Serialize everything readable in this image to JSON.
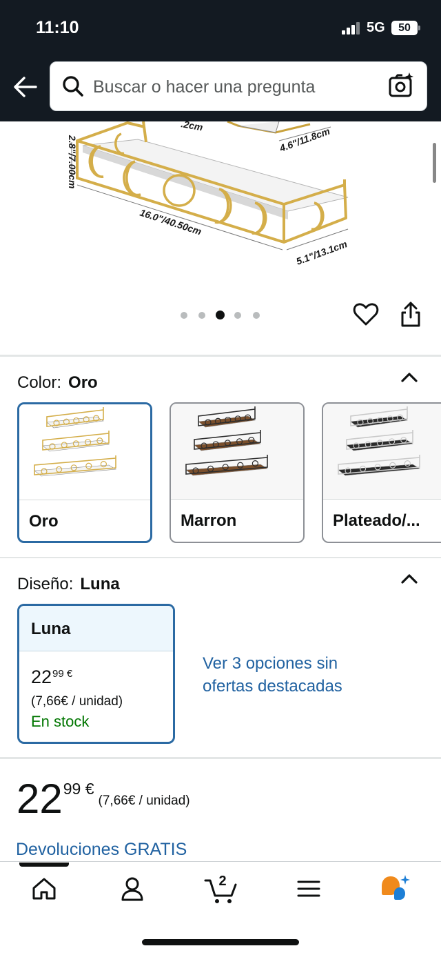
{
  "status_bar": {
    "time": "11:10",
    "network": "5G",
    "battery": "50"
  },
  "search": {
    "placeholder": "Buscar o hacer una pregunta",
    "icons": [
      "back-arrow-icon",
      "search-icon",
      "camera-icon"
    ]
  },
  "product_image": {
    "dimension_labels": [
      "2.8\"/7.00cm",
      "16.0\"/40.50cm",
      "5.1\"/13.1cm",
      "4.6\"/11.8cm",
      ".2cm"
    ],
    "carousel_count": 5,
    "carousel_active_index": 2
  },
  "color": {
    "label": "Color:",
    "selected": "Oro",
    "options": [
      {
        "name": "Oro",
        "selected": true,
        "shelf_color": "#f4f4f2",
        "frame_color": "#d4ae4a"
      },
      {
        "name": "Marron",
        "selected": false,
        "shelf_color": "#7a4f2c",
        "frame_color": "#2d2d2d"
      },
      {
        "name": "Plateado/...",
        "selected": false,
        "shelf_color": "#2a2a2a",
        "frame_color": "#c9c9c9"
      }
    ]
  },
  "design": {
    "label": "Diseño:",
    "selected": "Luna",
    "card": {
      "title": "Luna",
      "price_whole": "22",
      "price_fraction": "99 €",
      "unit_price": "(7,66€ / unidad)",
      "stock": "En stock"
    },
    "more_options": "Ver 3 opciones sin ofertas destacadas"
  },
  "price": {
    "whole": "22",
    "fraction": "99 €",
    "unit": "(7,66€ / unidad)"
  },
  "returns": "Devoluciones GRATIS",
  "bottom_nav": {
    "items": [
      "home-icon",
      "account-icon",
      "cart-icon",
      "menu-icon",
      "rufus-icon"
    ],
    "active": "home-icon",
    "cart_count": "2"
  },
  "colors": {
    "header_bg": "#131a22",
    "link": "#2162a1",
    "selected_border": "#2b6aa3",
    "in_stock": "#007600",
    "gold": "#d4ae4a"
  }
}
